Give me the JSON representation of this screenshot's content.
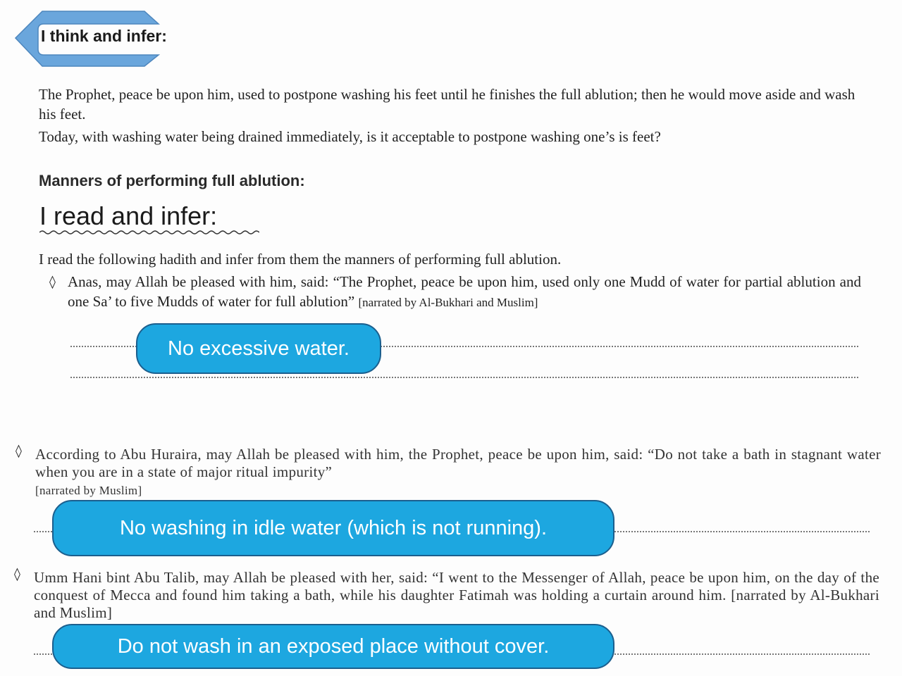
{
  "section1": {
    "banner_label": "I think and infer:",
    "paragraph1": "The Prophet, peace be upon him, used to postpone washing his feet until he finishes the full ablution; then he would move aside and wash his feet.",
    "paragraph2": "Today, with washing water being drained immediately, is it acceptable to postpone washing one’s is feet?"
  },
  "section2": {
    "heading": "Manners of performing full ablution:",
    "subheading": "I read and infer:",
    "intro": "I read the following hadith and infer from them the manners of performing full ablution.",
    "hadith1_text": "Anas, may Allah be pleased with him, said: “The Prophet, peace be upon him, used only one Mudd of water for partial ablution and one Sa’ to five Mudds of water for full ablution”",
    "hadith1_source": "[narrated by Al-Bukhari and Muslim]",
    "answer1": "No excessive water.",
    "hadith2_text": "According to Abu Huraira, may Allah be pleased with him, the Prophet, peace be upon him, said: “Do not take a bath in stagnant water when you are in a state of major ritual impurity”",
    "hadith2_source": "[narrated by Muslim]",
    "answer2": "No washing in idle water (which is not running).",
    "hadith3_text": "Umm Hani bint Abu Talib, may Allah be pleased with her, said: “I went to the Messenger of Allah, peace be upon him, on the day of the conquest of Mecca and found him taking a bath, while his daughter Fatimah was holding a curtain around him. [narrated by Al-Bukhari and Muslim]",
    "answer3": "Do not wash in an exposed place without cover."
  },
  "bullet_glyph": "◊",
  "colors": {
    "callout": "#1da7e0",
    "callout_border": "#1b5f8e",
    "banner": "#6aa6dc"
  }
}
